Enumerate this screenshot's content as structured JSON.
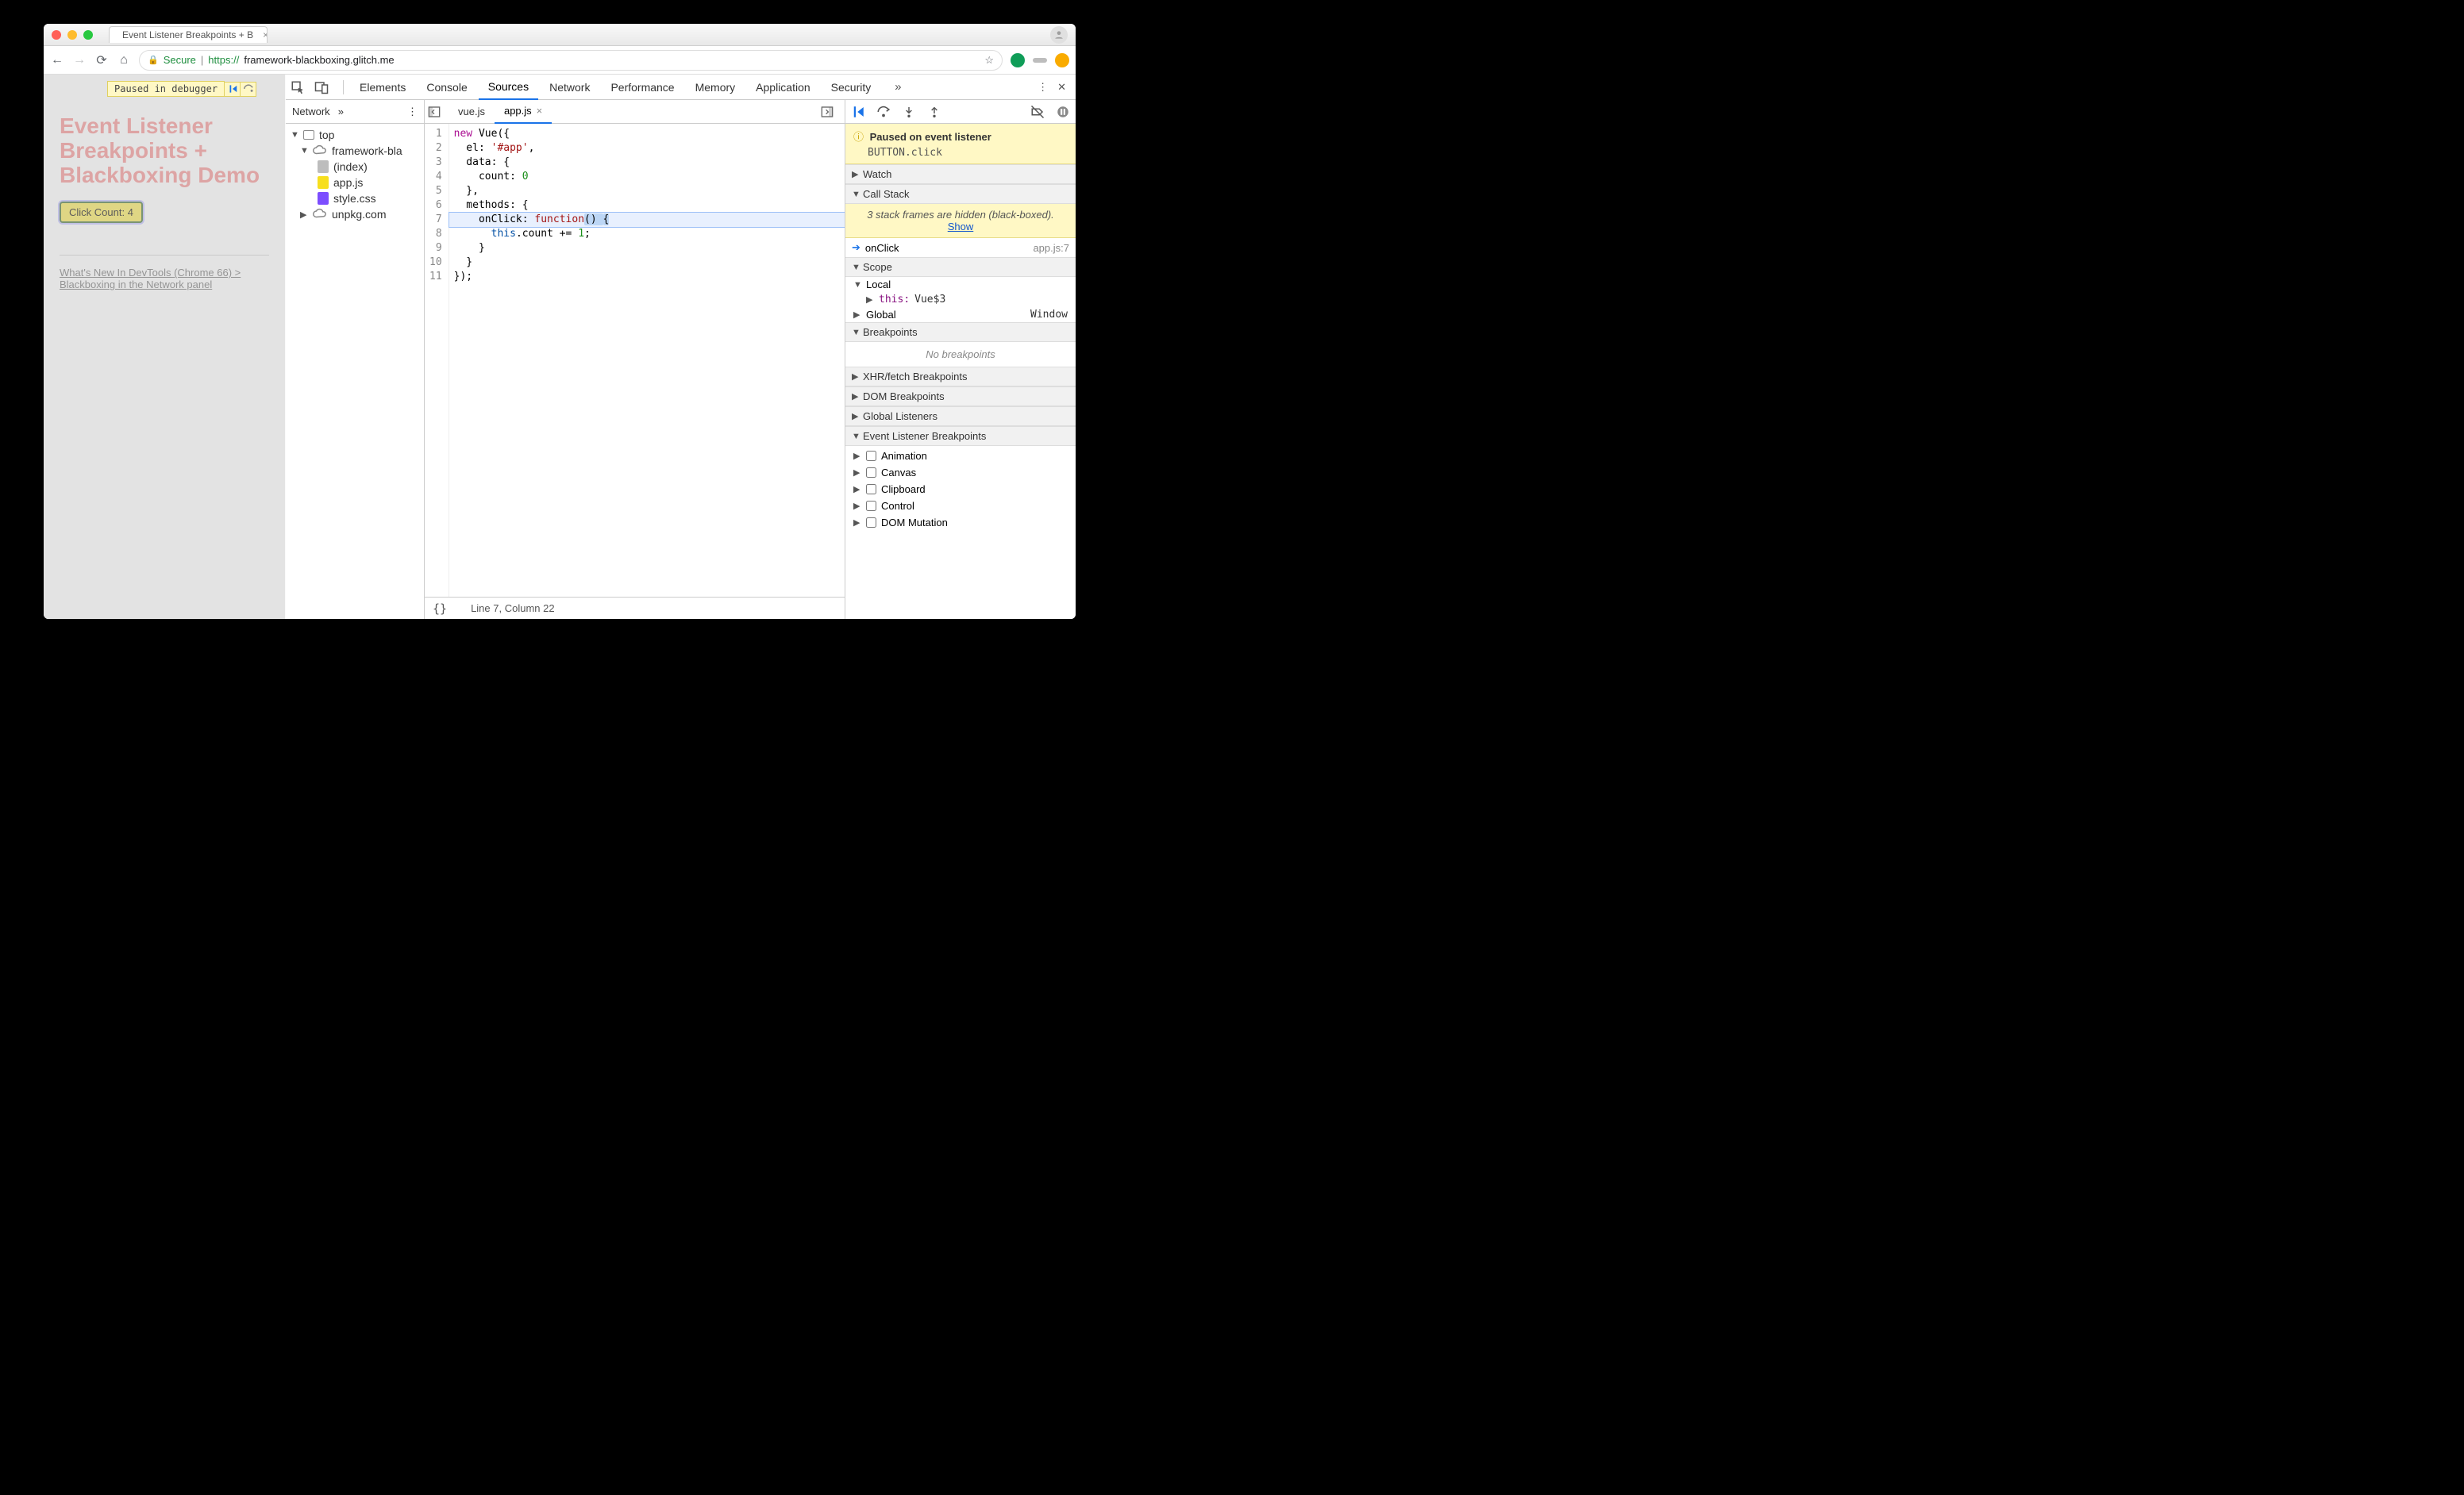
{
  "browser": {
    "tab_title": "Event Listener Breakpoints + B",
    "url_secure_label": "Secure",
    "url_proto": "https://",
    "url_host": "framework-blackboxing.glitch.me",
    "url_rest": ""
  },
  "page": {
    "paused_badge": "Paused in debugger",
    "title": "Event Listener Breakpoints + Blackboxing Demo",
    "click_btn_label": "Click Count: 4",
    "link_text": "What's New In DevTools (Chrome 66) > Blackboxing in the Network panel"
  },
  "devtools": {
    "tabs": [
      "Elements",
      "Console",
      "Sources",
      "Network",
      "Performance",
      "Memory",
      "Application",
      "Security"
    ],
    "active_tab": "Sources",
    "navigator": {
      "sub_tab": "Network",
      "tree": {
        "top": "top",
        "domain1": "framework-bla",
        "files": [
          {
            "name": "(index)",
            "kind": "doc"
          },
          {
            "name": "app.js",
            "kind": "js"
          },
          {
            "name": "style.css",
            "kind": "css"
          }
        ],
        "domain2": "unpkg.com"
      }
    },
    "editor": {
      "tabs": [
        "vue.js",
        "app.js"
      ],
      "active": "app.js",
      "lines": [
        {
          "n": 1,
          "text": "new Vue({"
        },
        {
          "n": 2,
          "text": "  el: '#app',"
        },
        {
          "n": 3,
          "text": "  data: {"
        },
        {
          "n": 4,
          "text": "    count: 0"
        },
        {
          "n": 5,
          "text": "  },"
        },
        {
          "n": 6,
          "text": "  methods: {"
        },
        {
          "n": 7,
          "text": "    onClick: function() {"
        },
        {
          "n": 8,
          "text": "      this.count += 1;"
        },
        {
          "n": 9,
          "text": "    }"
        },
        {
          "n": 10,
          "text": "  }"
        },
        {
          "n": 11,
          "text": "});"
        }
      ],
      "cursor_status": "Line 7, Column 22",
      "execution_line": 7
    },
    "debug": {
      "paused_title": "Paused on event listener",
      "paused_detail": "BUTTON.click",
      "sections": {
        "watch": "Watch",
        "callstack": "Call Stack",
        "blackbox_note": "3 stack frames are hidden (black-boxed).  ",
        "blackbox_show": "Show",
        "frame_name": "onClick",
        "frame_src": "app.js:7",
        "scope": "Scope",
        "scope_local": "Local",
        "scope_this_key": "this",
        "scope_this_val": "Vue$3",
        "scope_global": "Global",
        "scope_global_val": "Window",
        "breakpoints": "Breakpoints",
        "no_breakpoints": "No breakpoints",
        "xhr": "XHR/fetch Breakpoints",
        "dom": "DOM Breakpoints",
        "global_listeners": "Global Listeners",
        "event_bp": "Event Listener Breakpoints",
        "categories": [
          "Animation",
          "Canvas",
          "Clipboard",
          "Control",
          "DOM Mutation"
        ]
      }
    }
  }
}
